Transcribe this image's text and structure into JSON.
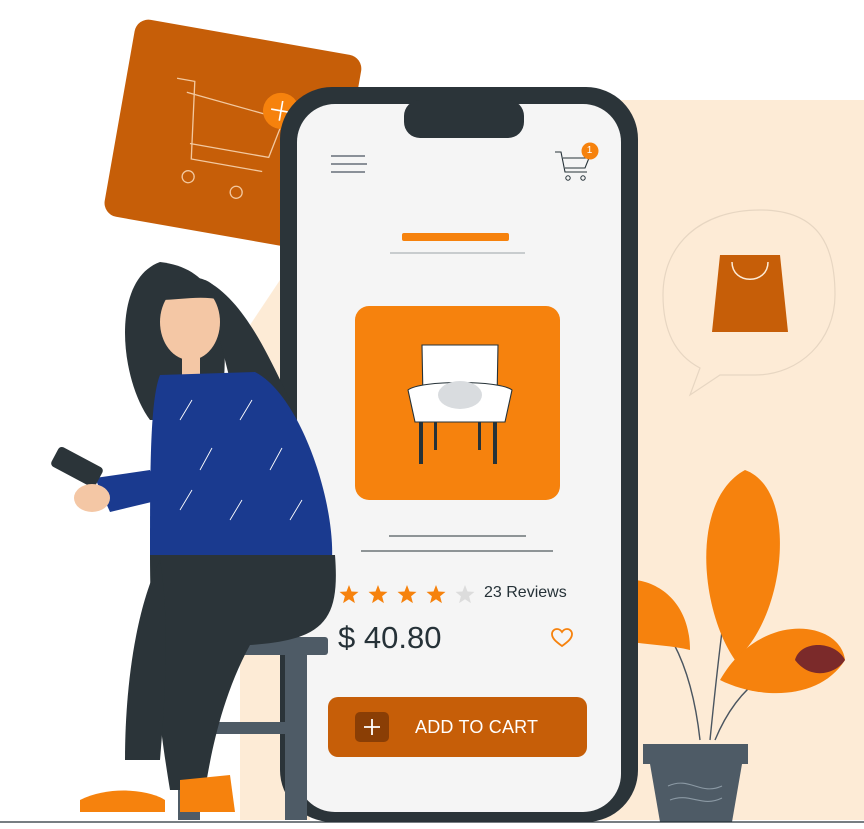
{
  "product": {
    "reviews_label": "23 Reviews",
    "price": "$ 40.80",
    "rating": 4,
    "rating_max": 5
  },
  "cart": {
    "badge_count": "1"
  },
  "actions": {
    "add_to_cart_label": "ADD TO CART"
  },
  "icons": {
    "menu": "hamburger-menu-icon",
    "cart": "cart-icon",
    "heart": "heart-icon",
    "plus": "plus-icon",
    "star": "star-icon",
    "chair": "armchair-illustration",
    "bag": "shopping-bag-icon"
  },
  "colors": {
    "accent": "#f6820d",
    "accent_dark": "#c65e08",
    "phone_frame": "#2b3439",
    "screen": "#f5f5f5",
    "peach_bg": "#fdebd6",
    "text": "#263238"
  }
}
